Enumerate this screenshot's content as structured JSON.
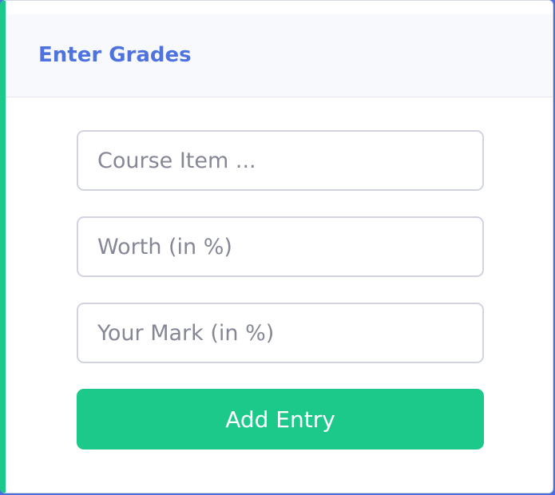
{
  "card": {
    "title": "Enter Grades"
  },
  "form": {
    "course_item_placeholder": "Course Item ...",
    "worth_placeholder": "Worth (in %)",
    "mark_placeholder": "Your Mark (in %)",
    "course_item_value": "",
    "worth_value": "",
    "mark_value": "",
    "submit_label": "Add Entry"
  },
  "colors": {
    "accent_green": "#1cc88a",
    "title_blue": "#4e73df",
    "header_bg": "#f8f9fc"
  }
}
